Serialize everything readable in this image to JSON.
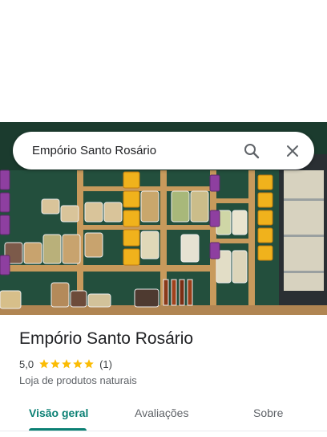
{
  "search": {
    "query": "Empório Santo Rosário"
  },
  "place": {
    "name": "Empório Santo Rosário",
    "rating": "5,0",
    "review_count": "(1)",
    "category": "Loja de produtos naturais"
  },
  "tabs": [
    {
      "label": "Visão geral",
      "active": true
    },
    {
      "label": "Avaliações",
      "active": false
    },
    {
      "label": "Sobre",
      "active": false
    }
  ],
  "colors": {
    "accent": "#0b8074",
    "star": "#fbbc04"
  }
}
